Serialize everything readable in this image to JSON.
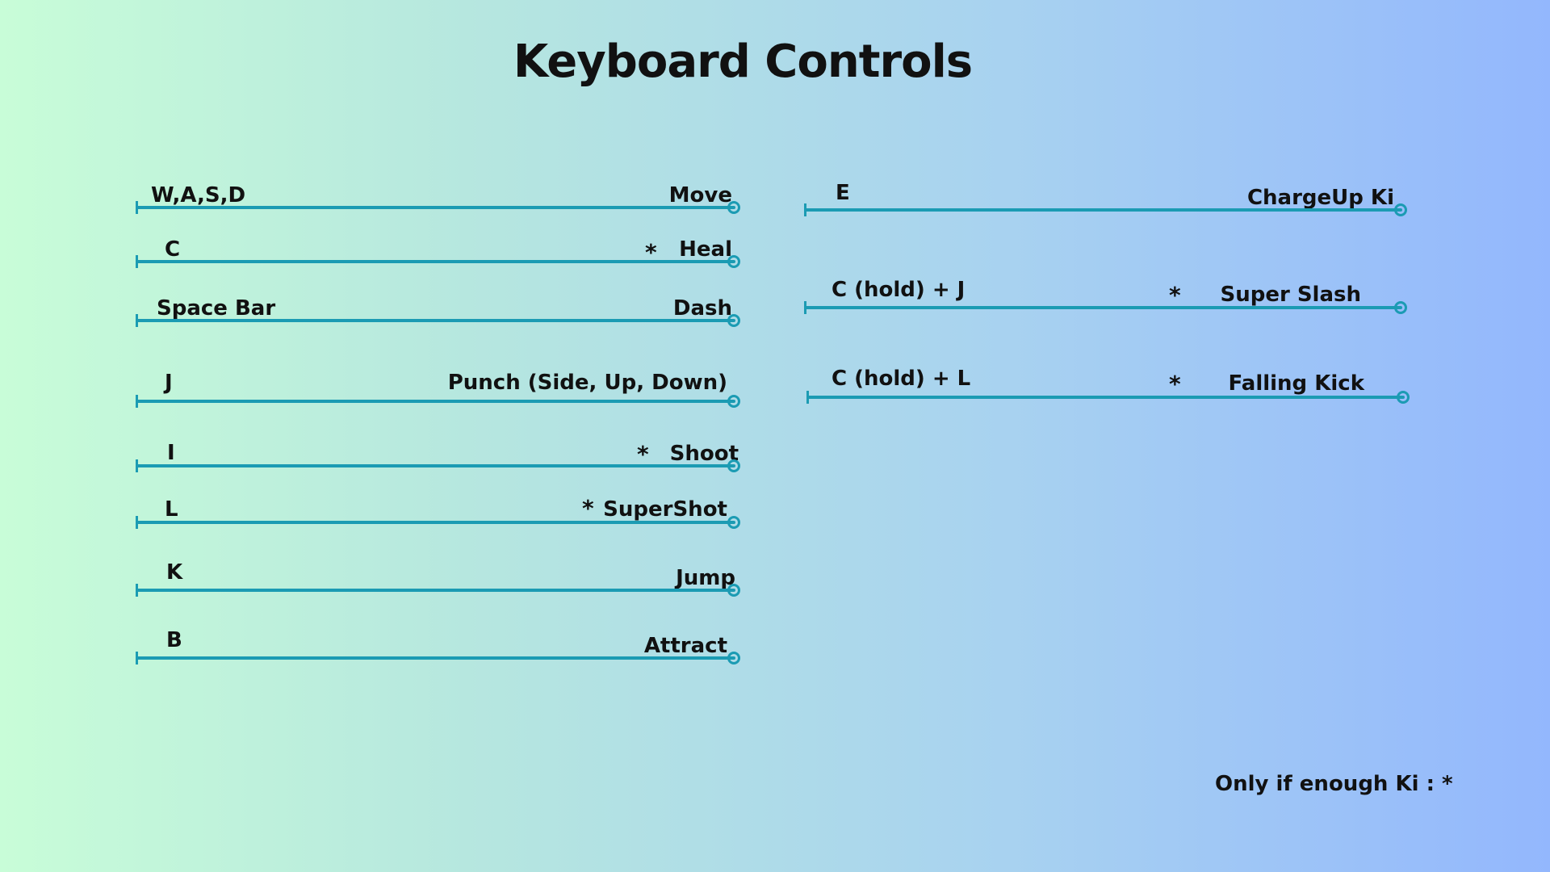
{
  "title": "Keyboard Controls",
  "footnote": "Only if enough Ki : *",
  "colors": {
    "line": "#1b9bb3",
    "text": "#111111",
    "gradient_start": "#c8fdd8",
    "gradient_end": "#93b7fd"
  },
  "left_controls": [
    {
      "key": "W,A,S,D",
      "action": "Move",
      "ki_required": false
    },
    {
      "key": "C",
      "action": "Heal",
      "ki_required": true
    },
    {
      "key": "Space Bar",
      "action": "Dash",
      "ki_required": false
    },
    {
      "key": "J",
      "action": "Punch (Side, Up, Down)",
      "ki_required": false
    },
    {
      "key": "I",
      "action": "Shoot",
      "ki_required": true
    },
    {
      "key": "L",
      "action": "SuperShot",
      "ki_required": true
    },
    {
      "key": "K",
      "action": "Jump",
      "ki_required": false
    },
    {
      "key": "B",
      "action": "Attract",
      "ki_required": false
    }
  ],
  "right_controls": [
    {
      "key": "E",
      "action": "ChargeUp Ki",
      "ki_required": false
    },
    {
      "key": "C (hold) + J",
      "action": "Super Slash",
      "ki_required": true
    },
    {
      "key": "C (hold) + L",
      "action": "Falling Kick",
      "ki_required": true
    }
  ],
  "ki_marker": "*"
}
